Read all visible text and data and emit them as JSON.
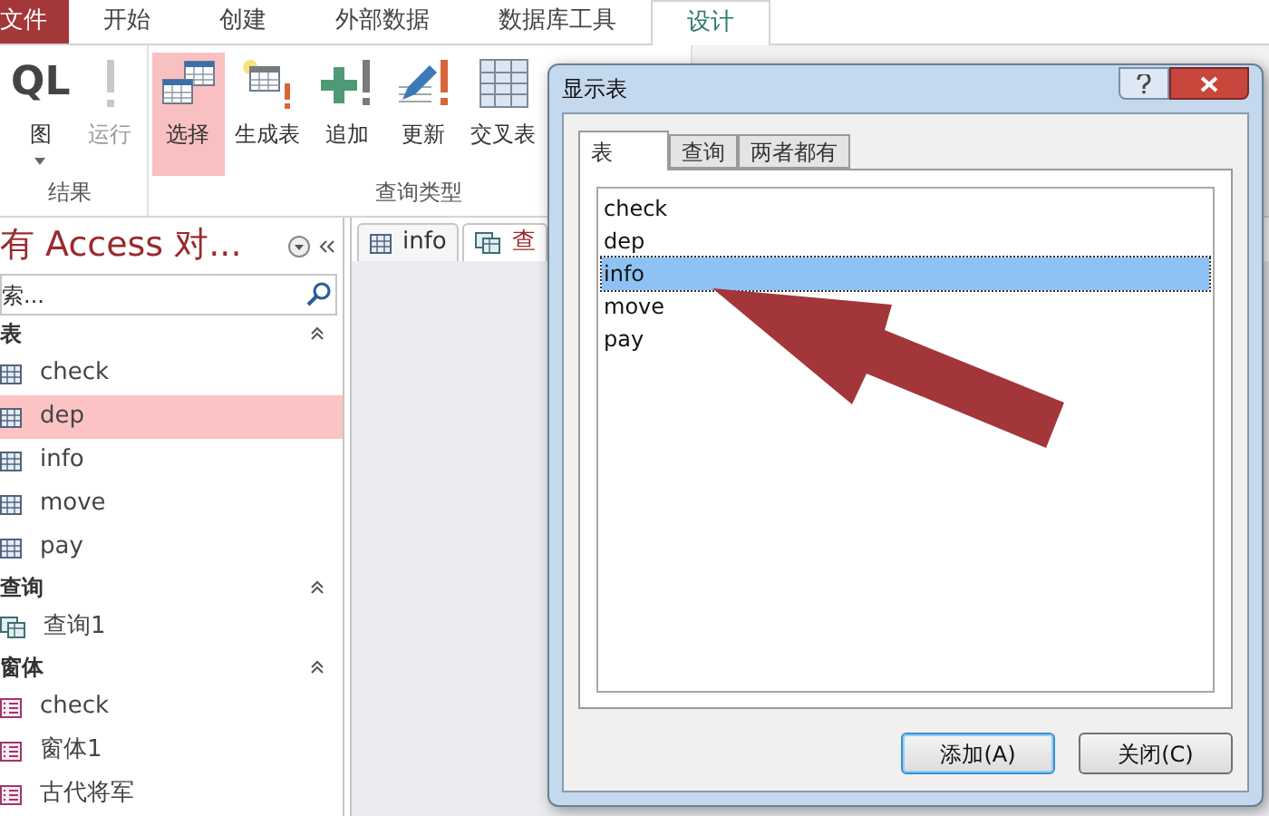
{
  "ribbon_tabs": [
    {
      "label": "文件",
      "kind": "file",
      "selected": false
    },
    {
      "label": "开始",
      "kind": "tab",
      "selected": false
    },
    {
      "label": "创建",
      "kind": "tab",
      "selected": false
    },
    {
      "label": "外部数据",
      "kind": "tab",
      "selected": false
    },
    {
      "label": "数据库工具",
      "kind": "tab",
      "selected": false
    },
    {
      "label": "设计",
      "kind": "tab",
      "selected": true
    }
  ],
  "ribbon_groups": [
    {
      "label": "结果",
      "buttons": [
        {
          "label": "图",
          "kind": "sql",
          "icon_text": "QL",
          "selected": false,
          "disabled": false
        },
        {
          "label": "运行",
          "kind": "run",
          "selected": false,
          "disabled": true
        }
      ]
    },
    {
      "label": "查询类型",
      "buttons": [
        {
          "label": "选择",
          "kind": "select",
          "selected": true,
          "disabled": false
        },
        {
          "label": "生成表",
          "kind": "make",
          "selected": false,
          "disabled": false
        },
        {
          "label": "追加",
          "kind": "append",
          "selected": false,
          "disabled": false
        },
        {
          "label": "更新",
          "kind": "update",
          "selected": false,
          "disabled": false
        },
        {
          "label": "交叉表",
          "kind": "crosstab",
          "selected": false,
          "disabled": false
        }
      ]
    }
  ],
  "nav_pane": {
    "title": "有 Access 对...",
    "search": {
      "placeholder": "索..."
    },
    "groups": [
      {
        "label": "表",
        "kind": "table",
        "items": [
          {
            "label": "check",
            "selected": false
          },
          {
            "label": "dep",
            "selected": true
          },
          {
            "label": "info",
            "selected": false
          },
          {
            "label": "move",
            "selected": false
          },
          {
            "label": "pay",
            "selected": false
          }
        ]
      },
      {
        "label": "查询",
        "kind": "query",
        "items": [
          {
            "label": "查询1",
            "selected": false
          }
        ]
      },
      {
        "label": "窗体",
        "kind": "form",
        "items": [
          {
            "label": "check",
            "selected": false
          },
          {
            "label": "窗体1",
            "selected": false
          },
          {
            "label": "古代将军",
            "selected": false
          }
        ]
      }
    ]
  },
  "document_tabs": [
    {
      "label": "info",
      "kind": "table",
      "selected": false
    },
    {
      "label": "查",
      "kind": "query",
      "selected": true
    }
  ],
  "dialog": {
    "title": "显示表",
    "tabs": [
      {
        "label": "表",
        "selected": true
      },
      {
        "label": "查询",
        "selected": false
      },
      {
        "label": "两者都有",
        "selected": false
      }
    ],
    "list": [
      {
        "label": "check",
        "selected": false
      },
      {
        "label": "dep",
        "selected": false
      },
      {
        "label": "info",
        "selected": true
      },
      {
        "label": "move",
        "selected": false
      },
      {
        "label": "pay",
        "selected": false
      }
    ],
    "buttons": [
      {
        "label": "添加(A)",
        "default": true
      },
      {
        "label": "关闭(C)",
        "default": false
      }
    ]
  }
}
